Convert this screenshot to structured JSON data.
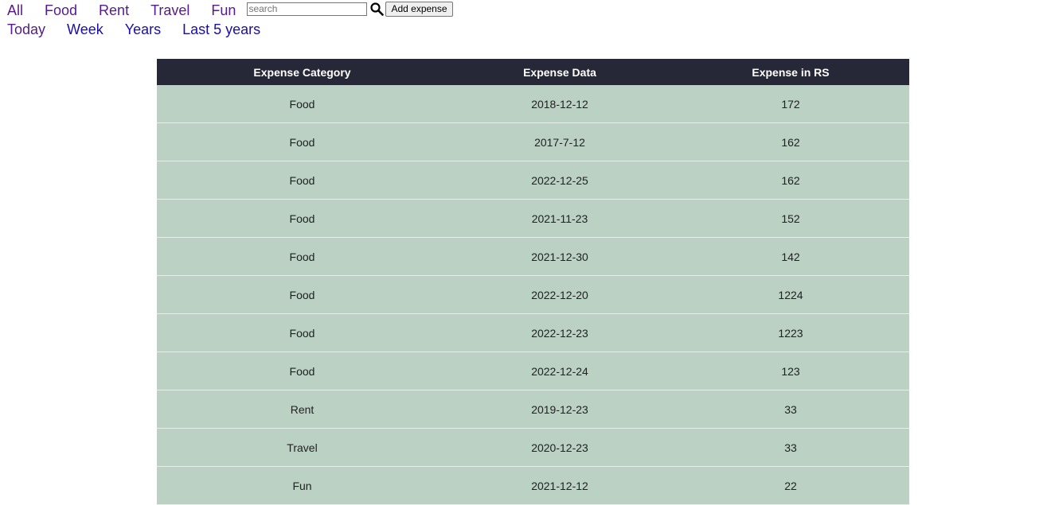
{
  "nav": {
    "categories": [
      "All",
      "Food",
      "Rent",
      "Travel",
      "Fun"
    ],
    "periods": [
      "Today",
      "Week",
      "Years",
      "Last 5 years"
    ]
  },
  "search": {
    "placeholder": "search",
    "value": "",
    "icon": "search-icon"
  },
  "add_button": {
    "label": "Add expense"
  },
  "table": {
    "headers": [
      "Expense Category",
      "Expense Data",
      "Expense in RS"
    ],
    "rows": [
      [
        "Food",
        "2018-12-12",
        "172"
      ],
      [
        "Food",
        "2017-7-12",
        "162"
      ],
      [
        "Food",
        "2022-12-25",
        "162"
      ],
      [
        "Food",
        "2021-11-23",
        "152"
      ],
      [
        "Food",
        "2021-12-30",
        "142"
      ],
      [
        "Food",
        "2022-12-20",
        "1224"
      ],
      [
        "Food",
        "2022-12-23",
        "1223"
      ],
      [
        "Food",
        "2022-12-24",
        "123"
      ],
      [
        "Rent",
        "2019-12-23",
        "33"
      ],
      [
        "Travel",
        "2020-12-23",
        "33"
      ],
      [
        "Fun",
        "2021-12-12",
        "22"
      ]
    ]
  },
  "colors": {
    "header_bg": "#262838",
    "row_bg": "#bad1c3",
    "visited_link": "#551a8b",
    "link": "#1a0dab"
  }
}
